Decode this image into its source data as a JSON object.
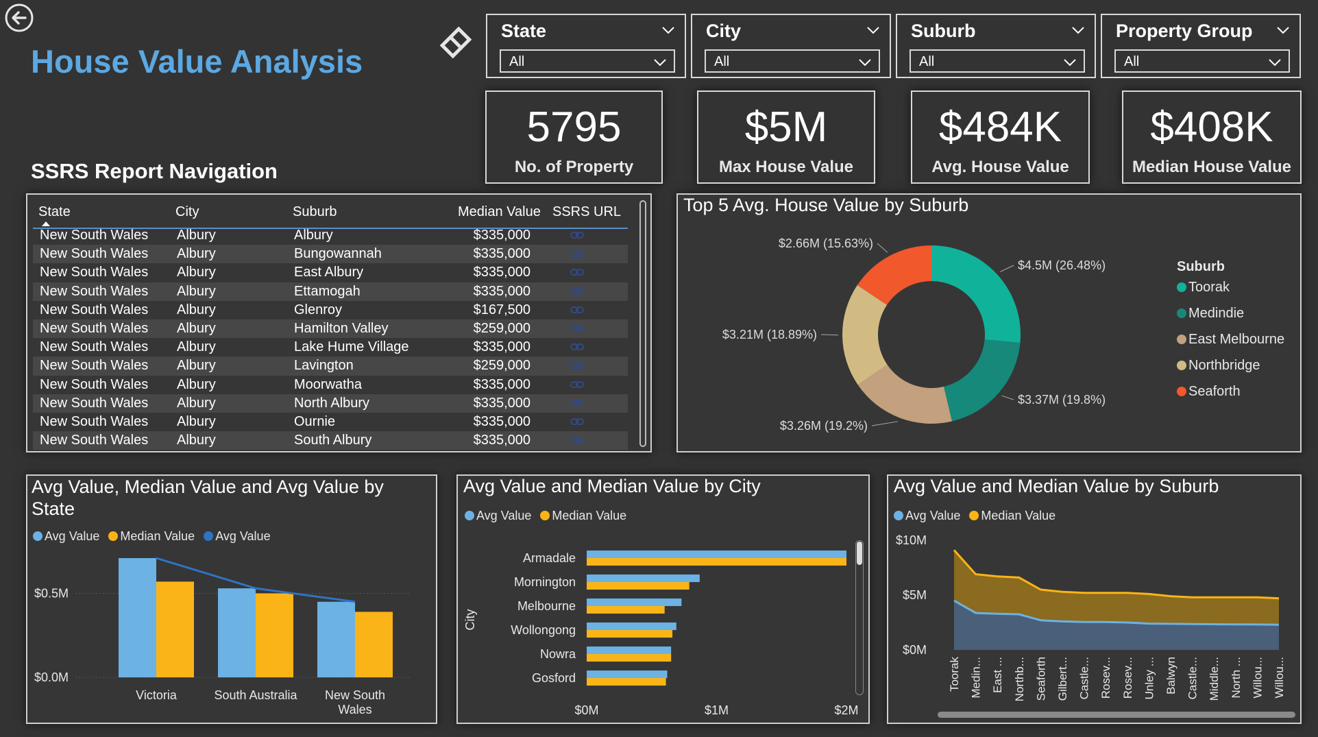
{
  "header": {
    "title": "House Value Analysis",
    "nav_title": "SSRS Report Navigation"
  },
  "slicers": [
    {
      "label": "State",
      "value": "All"
    },
    {
      "label": "City",
      "value": "All"
    },
    {
      "label": "Suburb",
      "value": "All"
    },
    {
      "label": "Property Group",
      "value": "All"
    }
  ],
  "kpis": [
    {
      "value": "5795",
      "caption": "No. of Property"
    },
    {
      "value": "$5M",
      "caption": "Max House Value"
    },
    {
      "value": "$484K",
      "caption": "Avg. House Value"
    },
    {
      "value": "$408K",
      "caption": "Median House Value"
    }
  ],
  "table": {
    "headers": [
      "State",
      "City",
      "Suburb",
      "Median Value",
      "SSRS URL"
    ],
    "rows": [
      [
        "New South Wales",
        "Albury",
        "Albury",
        "$335,000"
      ],
      [
        "New South Wales",
        "Albury",
        "Bungowannah",
        "$335,000"
      ],
      [
        "New South Wales",
        "Albury",
        "East Albury",
        "$335,000"
      ],
      [
        "New South Wales",
        "Albury",
        "Ettamogah",
        "$335,000"
      ],
      [
        "New South Wales",
        "Albury",
        "Glenroy",
        "$167,500"
      ],
      [
        "New South Wales",
        "Albury",
        "Hamilton Valley",
        "$259,000"
      ],
      [
        "New South Wales",
        "Albury",
        "Lake Hume Village",
        "$335,000"
      ],
      [
        "New South Wales",
        "Albury",
        "Lavington",
        "$259,000"
      ],
      [
        "New South Wales",
        "Albury",
        "Moorwatha",
        "$335,000"
      ],
      [
        "New South Wales",
        "Albury",
        "North Albury",
        "$335,000"
      ],
      [
        "New South Wales",
        "Albury",
        "Ournie",
        "$335,000"
      ],
      [
        "New South Wales",
        "Albury",
        "South Albury",
        "$335,000"
      ]
    ]
  },
  "colors": {
    "avg": "#6cb2e4",
    "median": "#fbb417",
    "avg_line": "#2e74c4",
    "area_avg": "#4a5f79",
    "area_median": "#8a6b1f"
  },
  "chart_data": [
    {
      "type": "pie",
      "title": "Top 5 Avg. House Value by Suburb",
      "legend_title": "Suburb",
      "categories": [
        "Toorak",
        "Medindie",
        "East Melbourne",
        "Northbridge",
        "Seaforth"
      ],
      "values": [
        4.5,
        3.37,
        3.26,
        3.21,
        2.66
      ],
      "labels": [
        "$4.5M (26.48%)",
        "$3.37M (19.8%)",
        "$3.26M (19.2%)",
        "$3.21M (18.89%)",
        "$2.66M (15.63%)"
      ],
      "colors": [
        "#10b39a",
        "#16897a",
        "#c3a07e",
        "#d2bb82",
        "#f1582c"
      ],
      "legend_position": "right"
    },
    {
      "type": "bar",
      "title": "Avg Value, Median Value and Avg Value by State",
      "categories": [
        "Victoria",
        "South Australia",
        "New South Wales"
      ],
      "series": [
        {
          "name": "Avg Value",
          "values": [
            0.71,
            0.53,
            0.45
          ]
        },
        {
          "name": "Median Value",
          "values": [
            0.57,
            0.5,
            0.39
          ]
        },
        {
          "name": "Avg Value",
          "values": [
            0.71,
            0.53,
            0.45
          ]
        }
      ],
      "ytick_labels": [
        "$0.0M",
        "$0.5M"
      ],
      "ylim": [
        0,
        0.8
      ],
      "legend_position": "top-left"
    },
    {
      "type": "bar",
      "orientation": "horizontal",
      "title": "Avg Value and Median Value by City",
      "ylabel": "City",
      "categories": [
        "Armadale",
        "Mornington",
        "Melbourne",
        "Wollongong",
        "Nowra",
        "Gosford"
      ],
      "series": [
        {
          "name": "Avg Value",
          "values": [
            2.0,
            0.87,
            0.73,
            0.69,
            0.65,
            0.62
          ]
        },
        {
          "name": "Median Value",
          "values": [
            2.0,
            0.79,
            0.6,
            0.66,
            0.65,
            0.61
          ]
        }
      ],
      "xtick_labels": [
        "$0M",
        "$1M",
        "$2M"
      ],
      "xlim": [
        0,
        2
      ],
      "legend_position": "top-left"
    },
    {
      "type": "area",
      "title": "Avg Value and Median Value by Suburb",
      "categories": [
        "Toorak",
        "Medin...",
        "East ...",
        "Northb...",
        "Seaforth",
        "Gilbert...",
        "Castle...",
        "Rosev...",
        "Rosev...",
        "Unley ...",
        "Balwyn",
        "Castle...",
        "Middle...",
        "North ...",
        "Willou...",
        "Willou..."
      ],
      "series": [
        {
          "name": "Avg Value",
          "values": [
            4.5,
            3.37,
            3.3,
            3.25,
            2.7,
            2.6,
            2.55,
            2.55,
            2.5,
            2.4,
            2.38,
            2.36,
            2.34,
            2.33,
            2.32,
            2.3
          ]
        },
        {
          "name": "Median Value",
          "values": [
            9.1,
            6.9,
            6.7,
            6.6,
            5.5,
            5.3,
            5.2,
            5.2,
            5.2,
            5.1,
            4.9,
            4.8,
            4.8,
            4.8,
            4.8,
            4.7
          ]
        }
      ],
      "ytick_labels": [
        "$0M",
        "$5M",
        "$10M"
      ],
      "ylim": [
        0,
        10
      ],
      "legend_position": "top-left"
    }
  ]
}
